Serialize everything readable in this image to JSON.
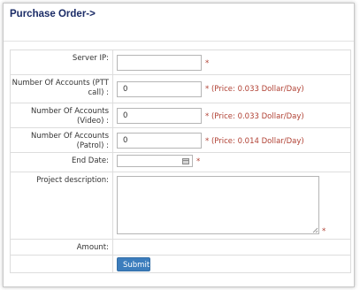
{
  "page": {
    "title": "Purchase Order->"
  },
  "form": {
    "required_mark": "*",
    "server_ip": {
      "label": "Server IP:",
      "value": ""
    },
    "ptt_accounts": {
      "label": "Number Of Accounts (PTT call) :",
      "value": "0",
      "price_note": "* (Price: 0.033 Dollar/Day)"
    },
    "video_accounts": {
      "label": "Number Of Accounts (Video) :",
      "value": "0",
      "price_note": "* (Price: 0.033 Dollar/Day)"
    },
    "patrol_accounts": {
      "label": "Number Of Accounts (Patrol) :",
      "value": "0",
      "price_note": "* (Price: 0.014 Dollar/Day)"
    },
    "end_date": {
      "label": "End Date:",
      "value": "",
      "icon": "calendar-icon"
    },
    "project_description": {
      "label": "Project description:",
      "value": ""
    },
    "amount": {
      "label": "Amount:",
      "value": ""
    },
    "submit_label": "Submit"
  },
  "colors": {
    "title": "#1a2b66",
    "price_note": "#b04033",
    "submit_bg": "#3c7dbd"
  }
}
